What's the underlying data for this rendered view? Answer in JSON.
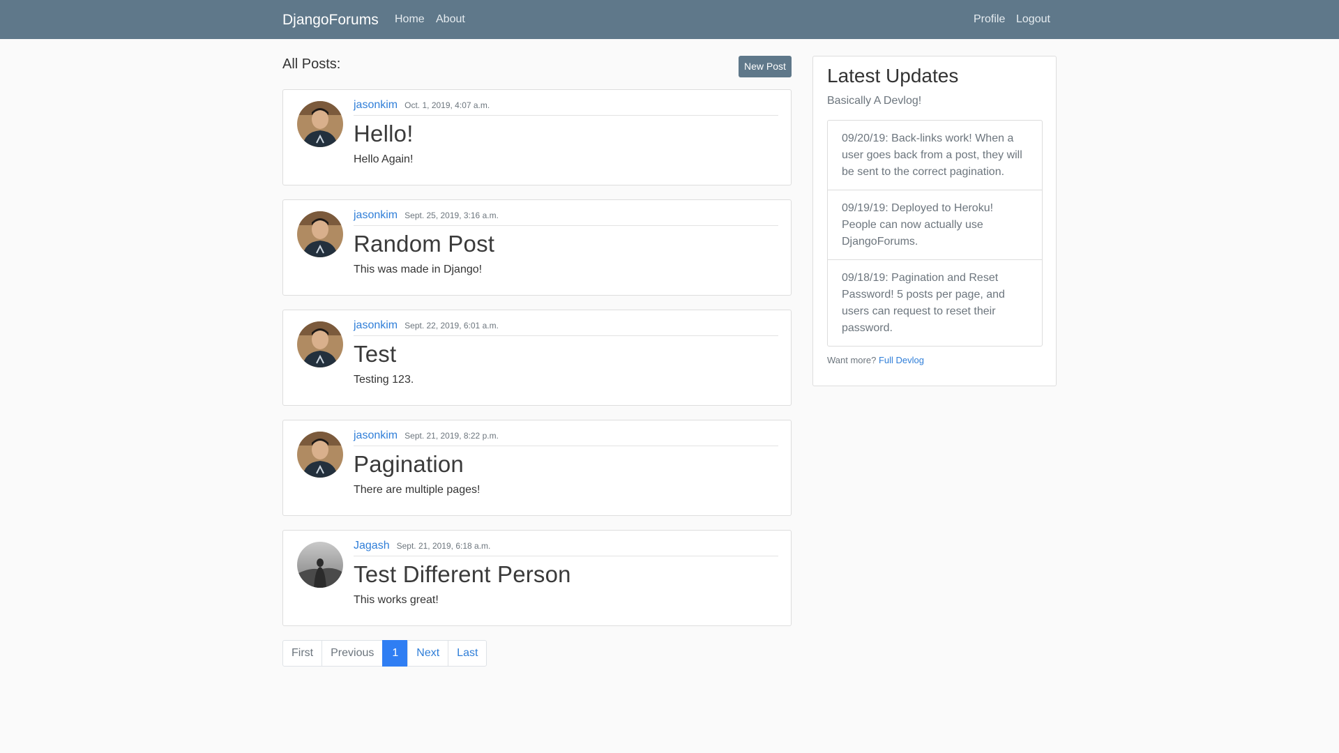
{
  "navbar": {
    "brand": "DjangoForums",
    "links_left": [
      "Home",
      "About"
    ],
    "links_right": [
      "Profile",
      "Logout"
    ]
  },
  "main": {
    "title": "All Posts:",
    "new_post_label": "New Post",
    "posts": [
      {
        "author": "jasonkim",
        "date": "Oct. 1, 2019, 4:07 a.m.",
        "title": "Hello!",
        "content": "Hello Again!",
        "avatar": "avatar-jasonkim"
      },
      {
        "author": "jasonkim",
        "date": "Sept. 25, 2019, 3:16 a.m.",
        "title": "Random Post",
        "content": "This was made in Django!",
        "avatar": "avatar-jasonkim"
      },
      {
        "author": "jasonkim",
        "date": "Sept. 22, 2019, 6:01 a.m.",
        "title": "Test",
        "content": "Testing 123.",
        "avatar": "avatar-jasonkim"
      },
      {
        "author": "jasonkim",
        "date": "Sept. 21, 2019, 8:22 p.m.",
        "title": "Pagination",
        "content": "There are multiple pages!",
        "avatar": "avatar-jasonkim"
      },
      {
        "author": "Jagash",
        "date": "Sept. 21, 2019, 6:18 a.m.",
        "title": "Test Different Person",
        "content": "This works great!",
        "avatar": "avatar-jagash"
      }
    ]
  },
  "pagination": {
    "first": "First",
    "previous": "Previous",
    "current": "1",
    "next": "Next",
    "last": "Last"
  },
  "sidebar": {
    "heading": "Latest Updates",
    "subheading": "Basically A Devlog!",
    "updates": [
      "09/20/19: Back-links work! When a user goes back from a post, they will be sent to the correct pagination.",
      "09/19/19: Deployed to Heroku! People can now actually use DjangoForums.",
      "09/18/19: Pagination and Reset Password! 5 posts per page, and users can request to reset their password."
    ],
    "more_text": "Want more?",
    "more_link": "Full Devlog"
  },
  "colors": {
    "navbar": "#5f788a",
    "link": "#2f7ed8",
    "active_page": "#2f7ef3",
    "background": "#fafafa"
  }
}
